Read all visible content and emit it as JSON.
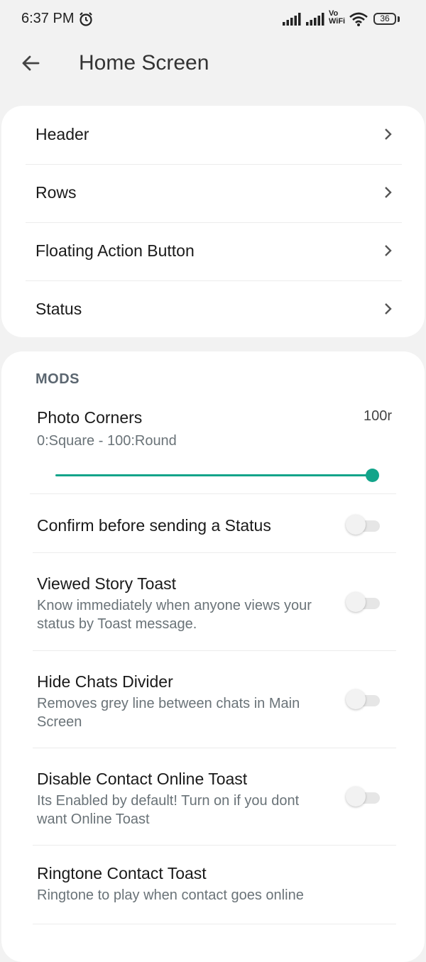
{
  "status_bar": {
    "time": "6:37 PM",
    "network_label_top": "Vo",
    "network_label_bottom": "WiFi",
    "battery": "36"
  },
  "toolbar": {
    "title": "Home Screen"
  },
  "nav_items": [
    {
      "label": "Header"
    },
    {
      "label": "Rows"
    },
    {
      "label": "Floating Action Button"
    },
    {
      "label": "Status"
    }
  ],
  "mods": {
    "section_title": "MODS",
    "photo_corners": {
      "title": "Photo Corners",
      "subtitle": "0:Square - 100:Round",
      "value_label": "100r",
      "value": 100,
      "min": 0,
      "max": 100
    },
    "prefs": [
      {
        "title": "Confirm before sending a Status",
        "subtitle": "",
        "enabled": false
      },
      {
        "title": "Viewed Story Toast",
        "subtitle": "Know immediately when anyone views your status by Toast message.",
        "enabled": false
      },
      {
        "title": "Hide Chats Divider",
        "subtitle": "Removes grey line between chats in Main Screen",
        "enabled": false
      },
      {
        "title": "Disable Contact Online Toast",
        "subtitle": "Its Enabled by default! Turn on if you dont want Online Toast",
        "enabled": false
      },
      {
        "title": "Ringtone Contact Toast",
        "subtitle": "Ringtone to play when contact goes online"
      }
    ]
  },
  "colors": {
    "accent": "#12a48a",
    "background": "#f2f2f2",
    "card": "#ffffff"
  }
}
